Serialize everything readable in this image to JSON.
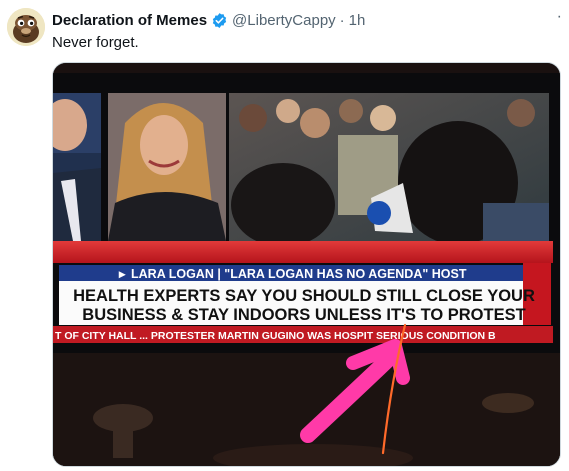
{
  "tweet": {
    "display_name": "Declaration of Memes",
    "handle": "@LibertyCappy",
    "separator": "·",
    "time": "1h",
    "text": "Never forget.",
    "more_icon": "ellipsis-icon",
    "verified_color": "#1d9bf0"
  },
  "tv": {
    "name_bar": "LARA LOGAN | \"LARA LOGAN HAS NO AGENDA\" HOST",
    "headline_line1": "HEALTH EXPERTS SAY YOU SHOULD STILL CLOSE YOUR",
    "headline_line2": "BUSINESS & STAY INDOORS UNLESS IT'S TO PROTEST",
    "ticker": "T OF CITY HALL ... PROTESTER MARTIN GUGINO WAS HOSPIT      SERIOUS CONDITION B"
  }
}
